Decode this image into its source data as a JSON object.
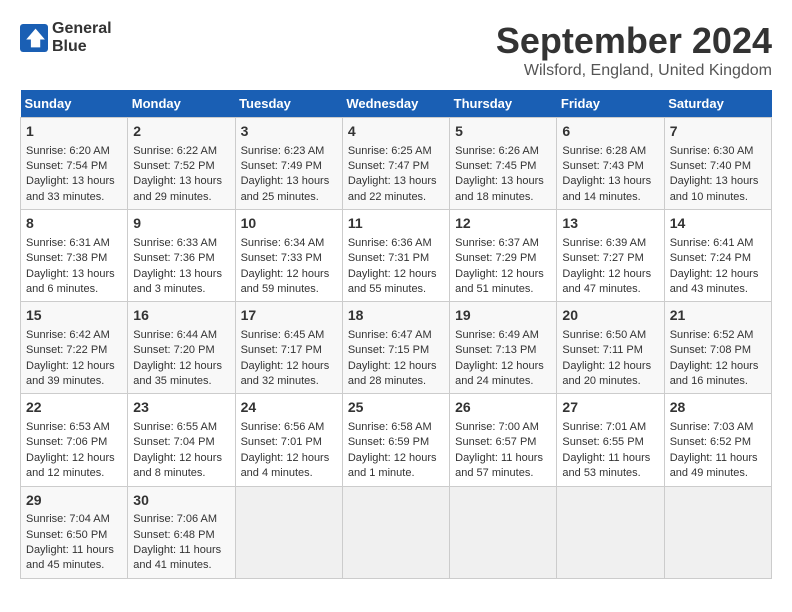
{
  "header": {
    "logo_line1": "General",
    "logo_line2": "Blue",
    "title": "September 2024",
    "subtitle": "Wilsford, England, United Kingdom"
  },
  "days_of_week": [
    "Sunday",
    "Monday",
    "Tuesday",
    "Wednesday",
    "Thursday",
    "Friday",
    "Saturday"
  ],
  "weeks": [
    [
      {
        "day": "1",
        "lines": [
          "Sunrise: 6:20 AM",
          "Sunset: 7:54 PM",
          "Daylight: 13 hours",
          "and 33 minutes."
        ]
      },
      {
        "day": "2",
        "lines": [
          "Sunrise: 6:22 AM",
          "Sunset: 7:52 PM",
          "Daylight: 13 hours",
          "and 29 minutes."
        ]
      },
      {
        "day": "3",
        "lines": [
          "Sunrise: 6:23 AM",
          "Sunset: 7:49 PM",
          "Daylight: 13 hours",
          "and 25 minutes."
        ]
      },
      {
        "day": "4",
        "lines": [
          "Sunrise: 6:25 AM",
          "Sunset: 7:47 PM",
          "Daylight: 13 hours",
          "and 22 minutes."
        ]
      },
      {
        "day": "5",
        "lines": [
          "Sunrise: 6:26 AM",
          "Sunset: 7:45 PM",
          "Daylight: 13 hours",
          "and 18 minutes."
        ]
      },
      {
        "day": "6",
        "lines": [
          "Sunrise: 6:28 AM",
          "Sunset: 7:43 PM",
          "Daylight: 13 hours",
          "and 14 minutes."
        ]
      },
      {
        "day": "7",
        "lines": [
          "Sunrise: 6:30 AM",
          "Sunset: 7:40 PM",
          "Daylight: 13 hours",
          "and 10 minutes."
        ]
      }
    ],
    [
      {
        "day": "8",
        "lines": [
          "Sunrise: 6:31 AM",
          "Sunset: 7:38 PM",
          "Daylight: 13 hours",
          "and 6 minutes."
        ]
      },
      {
        "day": "9",
        "lines": [
          "Sunrise: 6:33 AM",
          "Sunset: 7:36 PM",
          "Daylight: 13 hours",
          "and 3 minutes."
        ]
      },
      {
        "day": "10",
        "lines": [
          "Sunrise: 6:34 AM",
          "Sunset: 7:33 PM",
          "Daylight: 12 hours",
          "and 59 minutes."
        ]
      },
      {
        "day": "11",
        "lines": [
          "Sunrise: 6:36 AM",
          "Sunset: 7:31 PM",
          "Daylight: 12 hours",
          "and 55 minutes."
        ]
      },
      {
        "day": "12",
        "lines": [
          "Sunrise: 6:37 AM",
          "Sunset: 7:29 PM",
          "Daylight: 12 hours",
          "and 51 minutes."
        ]
      },
      {
        "day": "13",
        "lines": [
          "Sunrise: 6:39 AM",
          "Sunset: 7:27 PM",
          "Daylight: 12 hours",
          "and 47 minutes."
        ]
      },
      {
        "day": "14",
        "lines": [
          "Sunrise: 6:41 AM",
          "Sunset: 7:24 PM",
          "Daylight: 12 hours",
          "and 43 minutes."
        ]
      }
    ],
    [
      {
        "day": "15",
        "lines": [
          "Sunrise: 6:42 AM",
          "Sunset: 7:22 PM",
          "Daylight: 12 hours",
          "and 39 minutes."
        ]
      },
      {
        "day": "16",
        "lines": [
          "Sunrise: 6:44 AM",
          "Sunset: 7:20 PM",
          "Daylight: 12 hours",
          "and 35 minutes."
        ]
      },
      {
        "day": "17",
        "lines": [
          "Sunrise: 6:45 AM",
          "Sunset: 7:17 PM",
          "Daylight: 12 hours",
          "and 32 minutes."
        ]
      },
      {
        "day": "18",
        "lines": [
          "Sunrise: 6:47 AM",
          "Sunset: 7:15 PM",
          "Daylight: 12 hours",
          "and 28 minutes."
        ]
      },
      {
        "day": "19",
        "lines": [
          "Sunrise: 6:49 AM",
          "Sunset: 7:13 PM",
          "Daylight: 12 hours",
          "and 24 minutes."
        ]
      },
      {
        "day": "20",
        "lines": [
          "Sunrise: 6:50 AM",
          "Sunset: 7:11 PM",
          "Daylight: 12 hours",
          "and 20 minutes."
        ]
      },
      {
        "day": "21",
        "lines": [
          "Sunrise: 6:52 AM",
          "Sunset: 7:08 PM",
          "Daylight: 12 hours",
          "and 16 minutes."
        ]
      }
    ],
    [
      {
        "day": "22",
        "lines": [
          "Sunrise: 6:53 AM",
          "Sunset: 7:06 PM",
          "Daylight: 12 hours",
          "and 12 minutes."
        ]
      },
      {
        "day": "23",
        "lines": [
          "Sunrise: 6:55 AM",
          "Sunset: 7:04 PM",
          "Daylight: 12 hours",
          "and 8 minutes."
        ]
      },
      {
        "day": "24",
        "lines": [
          "Sunrise: 6:56 AM",
          "Sunset: 7:01 PM",
          "Daylight: 12 hours",
          "and 4 minutes."
        ]
      },
      {
        "day": "25",
        "lines": [
          "Sunrise: 6:58 AM",
          "Sunset: 6:59 PM",
          "Daylight: 12 hours",
          "and 1 minute."
        ]
      },
      {
        "day": "26",
        "lines": [
          "Sunrise: 7:00 AM",
          "Sunset: 6:57 PM",
          "Daylight: 11 hours",
          "and 57 minutes."
        ]
      },
      {
        "day": "27",
        "lines": [
          "Sunrise: 7:01 AM",
          "Sunset: 6:55 PM",
          "Daylight: 11 hours",
          "and 53 minutes."
        ]
      },
      {
        "day": "28",
        "lines": [
          "Sunrise: 7:03 AM",
          "Sunset: 6:52 PM",
          "Daylight: 11 hours",
          "and 49 minutes."
        ]
      }
    ],
    [
      {
        "day": "29",
        "lines": [
          "Sunrise: 7:04 AM",
          "Sunset: 6:50 PM",
          "Daylight: 11 hours",
          "and 45 minutes."
        ]
      },
      {
        "day": "30",
        "lines": [
          "Sunrise: 7:06 AM",
          "Sunset: 6:48 PM",
          "Daylight: 11 hours",
          "and 41 minutes."
        ]
      },
      {
        "day": "",
        "lines": [],
        "empty": true
      },
      {
        "day": "",
        "lines": [],
        "empty": true
      },
      {
        "day": "",
        "lines": [],
        "empty": true
      },
      {
        "day": "",
        "lines": [],
        "empty": true
      },
      {
        "day": "",
        "lines": [],
        "empty": true
      }
    ]
  ]
}
